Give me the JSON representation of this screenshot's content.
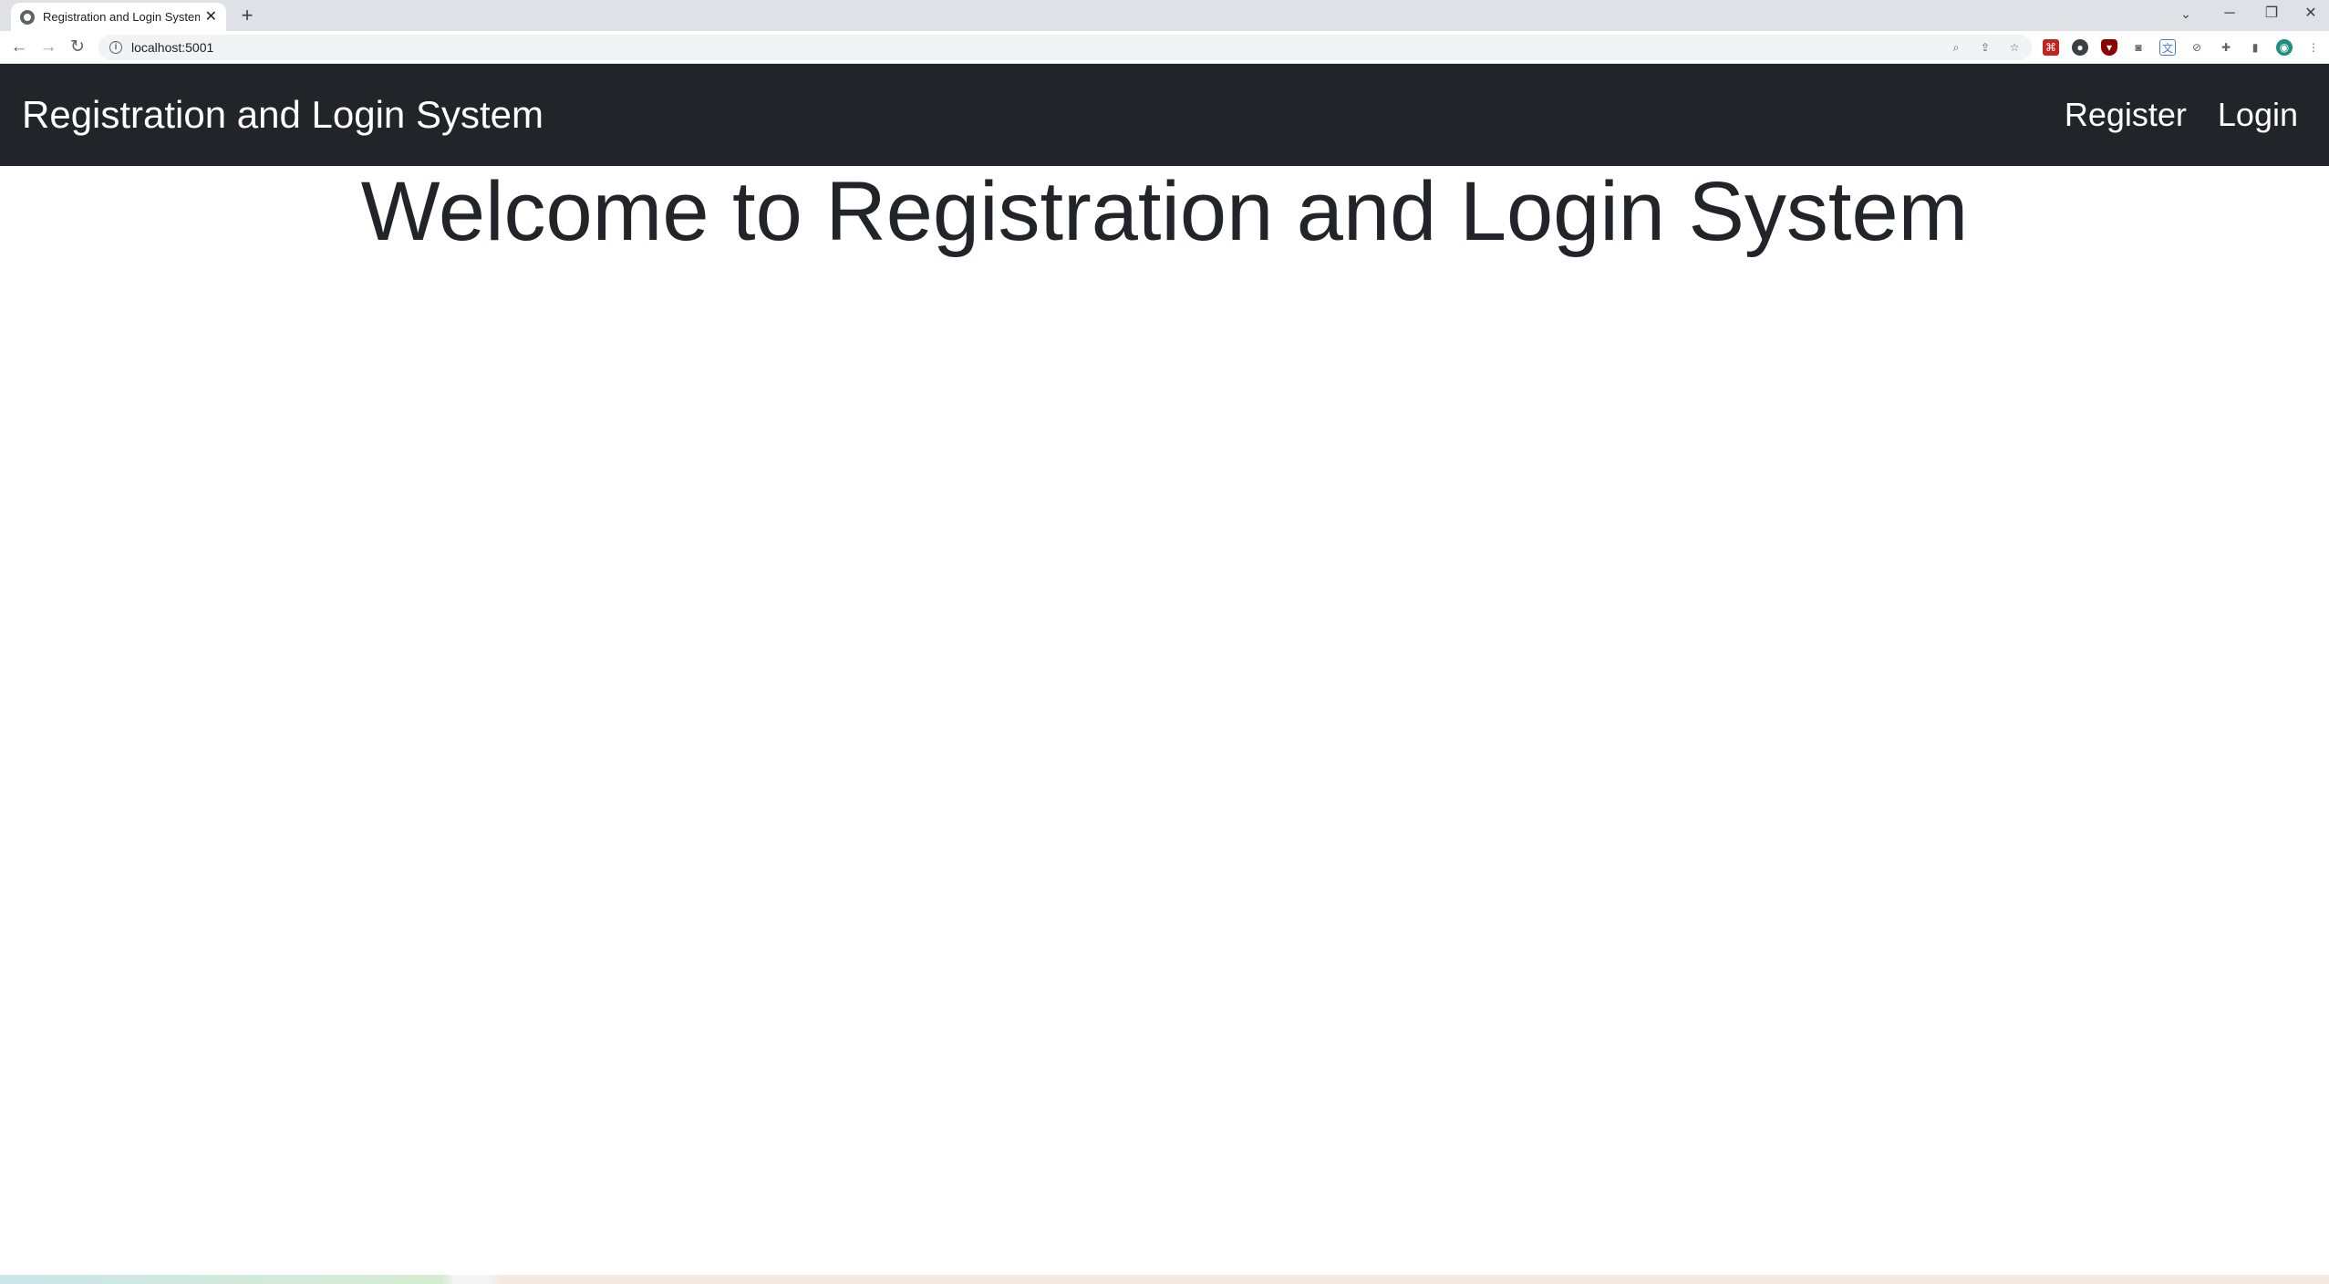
{
  "browser": {
    "tab_title": "Registration and Login System",
    "tab_close": "✕",
    "new_tab": "+",
    "url": "localhost:5001",
    "window_controls": {
      "minimize": "─",
      "restore": "❐",
      "close": "✕",
      "tab_search": "⌄"
    },
    "nav": {
      "back": "←",
      "forward": "→",
      "reload": "↻"
    },
    "toolbar_icons": [
      "zoom-icon",
      "share-icon",
      "bookmark-star-icon",
      "pdf-extension-icon",
      "extension-icon",
      "ublock-extension-icon",
      "camera-extension-icon",
      "translate-extension-icon",
      "extension-icon",
      "puzzle-extensions-icon",
      "side-panel-icon",
      "profile-avatar-icon",
      "menu-kebab-icon"
    ]
  },
  "navbar": {
    "brand": "Registration and Login System",
    "links": {
      "register": "Register",
      "login": "Login"
    },
    "background": "#212529"
  },
  "main": {
    "heading": "Welcome to Registration and Login System"
  }
}
